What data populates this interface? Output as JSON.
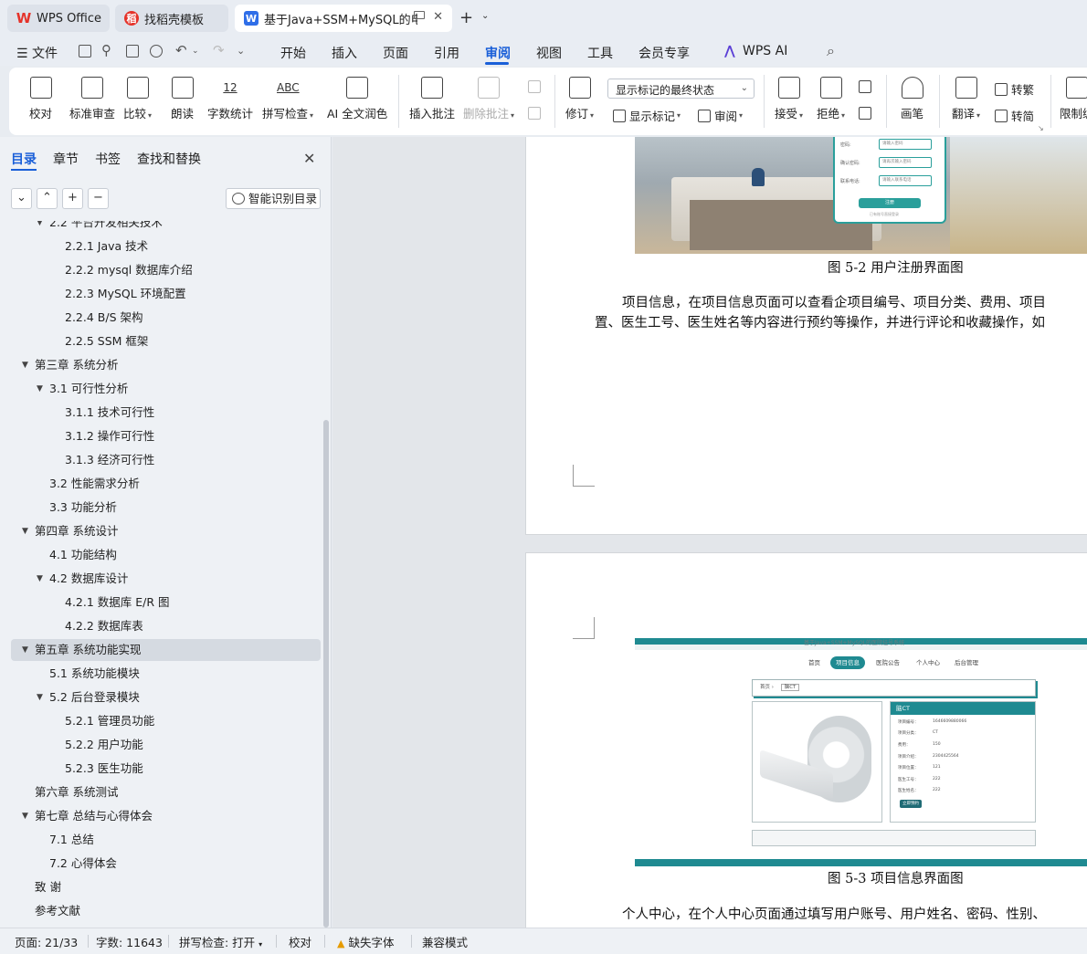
{
  "tabs": [
    {
      "label": "WPS Office",
      "icon": "wps-logo-icon"
    },
    {
      "label": "找稻壳模板",
      "icon": "daoke-icon"
    },
    {
      "label": "基于Java+SSM+MySQL的电",
      "icon": "word-doc-icon"
    }
  ],
  "menus": {
    "file": "文件",
    "items": [
      "开始",
      "插入",
      "页面",
      "引用",
      "审阅",
      "视图",
      "工具",
      "会员专享",
      "WPS AI"
    ],
    "active": "审阅"
  },
  "ribbon": {
    "proofread": "校对",
    "standard_review": "标准审查",
    "compare": "比较",
    "read_aloud": "朗读",
    "word_count": "字数统计",
    "word_count_icon_text": "12",
    "spell_check": "拼写检查",
    "spell_icon_text": "ABC",
    "ai_polish": "AI 全文润色",
    "insert_comment": "插入批注",
    "delete_comment": "删除批注",
    "track_changes": "修订",
    "display_select": "显示标记的最终状态",
    "show_markup": "显示标记",
    "review_pane": "审阅",
    "accept": "接受",
    "reject": "拒绝",
    "pen": "画笔",
    "translate": "翻译",
    "to_traditional": "转繁",
    "to_simplified": "转简",
    "restrict_edit": "限制编"
  },
  "sidebar": {
    "tabs": [
      "目录",
      "章节",
      "书签",
      "查找和替换"
    ],
    "active_tab": "目录",
    "buttons": {
      "collapse": "⌄",
      "expand": "⌃",
      "add": "+",
      "remove": "−"
    },
    "smart_toc": "智能识别目录",
    "toc": [
      {
        "text": "2.2  平台开发相关技术",
        "level": 2,
        "arrow": true,
        "partial": true
      },
      {
        "text": "2.2.1   Java 技术",
        "level": 3
      },
      {
        "text": "2.2.2   mysql 数据库介绍",
        "level": 3
      },
      {
        "text": "2.2.3   MySQL 环境配置",
        "level": 3
      },
      {
        "text": "2.2.4   B/S 架构",
        "level": 3
      },
      {
        "text": "2.2.5   SSM 框架",
        "level": 3
      },
      {
        "text": "第三章  系统分析",
        "level": 1,
        "arrow": true
      },
      {
        "text": "3.1  可行性分析",
        "level": 2,
        "arrow": true
      },
      {
        "text": "3.1.1 技术可行性",
        "level": 3
      },
      {
        "text": "3.1.2 操作可行性",
        "level": 3
      },
      {
        "text": "3.1.3  经济可行性",
        "level": 3
      },
      {
        "text": "3.2 性能需求分析",
        "level": 2
      },
      {
        "text": "3.3 功能分析",
        "level": 2
      },
      {
        "text": "第四章  系统设计",
        "level": 1,
        "arrow": true
      },
      {
        "text": "4.1 功能结构",
        "level": 2
      },
      {
        "text": "4.2  数据库设计",
        "level": 2,
        "arrow": true
      },
      {
        "text": "4.2.1  数据库 E/R 图",
        "level": 3
      },
      {
        "text": "4.2.2  数据库表",
        "level": 3
      },
      {
        "text": "第五章  系统功能实现",
        "level": 1,
        "arrow": true,
        "active": true
      },
      {
        "text": "5.1 系统功能模块",
        "level": 2
      },
      {
        "text": "5.2 后台登录模块",
        "level": 2,
        "arrow": true
      },
      {
        "text": "5.2.1 管理员功能",
        "level": 3
      },
      {
        "text": "5.2.2 用户功能",
        "level": 3
      },
      {
        "text": "5.2.3 医生功能",
        "level": 3
      },
      {
        "text": "第六章  系统测试",
        "level": 1
      },
      {
        "text": "第七章  总结与心得体会",
        "level": 1,
        "arrow": true
      },
      {
        "text": "7.1  总结",
        "level": 2
      },
      {
        "text": "7.2  心得体会",
        "level": 2
      },
      {
        "text": "致  谢",
        "level": 1
      },
      {
        "text": "参考文献",
        "level": 1
      }
    ]
  },
  "document": {
    "fig1": {
      "form_rows": [
        {
          "label": "密码:",
          "placeholder": "请输入密码"
        },
        {
          "label": "确认密码:",
          "placeholder": "请再次输入密码"
        },
        {
          "label": "联系电话:",
          "placeholder": "请输入联系电话"
        }
      ],
      "button": "注册",
      "note": "已有账号直接登录"
    },
    "caption1": "图 5-2 用户注册界面图",
    "para1_line1": "项目信息，在项目信息页面可以查看企项目编号、项目分类、费用、项目",
    "para1_line2": "置、医生工号、医生姓名等内容进行预约等操作，并进行评论和收藏操作，如",
    "fig2": {
      "site_title": "基于Java+SSM+MySQL的医院挂号系统",
      "nav": [
        "首页",
        "项目信息",
        "医院公告",
        "个人中心",
        "后台管理"
      ],
      "nav_active": "项目信息",
      "crumb": [
        "首页",
        "脑CT"
      ],
      "info_title": "脑CT",
      "info_rows": [
        {
          "label": "项目编号：",
          "value": "1646609880066"
        },
        {
          "label": "项目分类：",
          "value": "CT"
        },
        {
          "label": "费用：",
          "value": "150"
        },
        {
          "label": "项目介绍：",
          "value": "2304425564"
        },
        {
          "label": "项目位置：",
          "value": "121"
        },
        {
          "label": "医生工号：",
          "value": "222"
        },
        {
          "label": "医生姓名：",
          "value": "222"
        }
      ],
      "book_button": "立即预约"
    },
    "caption2": "图 5-3 项目信息界面图",
    "para2_line1": "个人中心，在个人中心页面通过填写用户账号、用户姓名、密码、性别、"
  },
  "statusbar": {
    "page": "页面: 21/33",
    "words": "字数: 11643",
    "spell": "拼写检查: 打开",
    "proof": "校对",
    "missing_font": "缺失字体",
    "compat": "兼容模式"
  },
  "colors": {
    "accent": "#1a5fd8",
    "teal": "#1f8a91",
    "wps_red": "#e5332a"
  }
}
